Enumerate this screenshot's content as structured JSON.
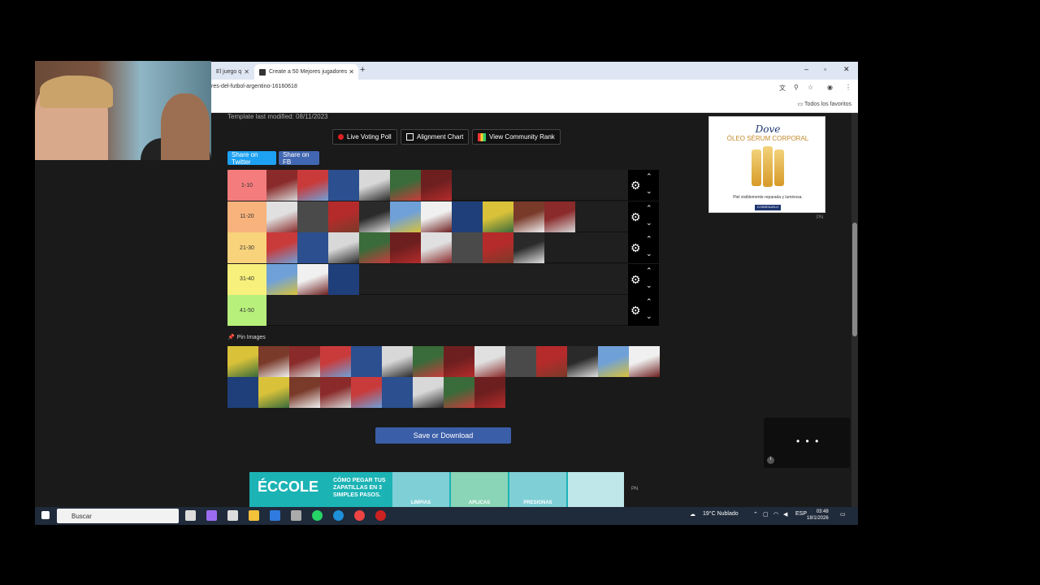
{
  "browser": {
    "tabs": [
      {
        "label": "El juego q"
      },
      {
        "label": "Create a 50 Mejores jugadores"
      }
    ],
    "new_tab": "+",
    "window_controls": {
      "minimize": "–",
      "maximize": "▫",
      "close": "✕"
    },
    "url": "res-del-futbol-argentino-16160618",
    "bookmarks_label": "Todos los favoritos"
  },
  "page": {
    "template_modified": "Template last modified: 08/11/2023",
    "buttons": {
      "live_voting": "Live Voting Poll",
      "alignment": "Alignment Chart",
      "community": "View Community Rank"
    },
    "share": {
      "twitter": "Share on Twitter",
      "facebook": "Share on FB"
    },
    "tiers": [
      {
        "label": "1-10",
        "color": "#f47c7c",
        "count": 6
      },
      {
        "label": "11-20",
        "color": "#f8b37c",
        "count": 10
      },
      {
        "label": "21-30",
        "color": "#f9d27c",
        "count": 9
      },
      {
        "label": "31-40",
        "color": "#f8f07c",
        "count": 3
      },
      {
        "label": "41-50",
        "color": "#b8f07c",
        "count": 0
      }
    ],
    "pin_images": "Pin Images",
    "pool_count": 23,
    "save_button": "Save or Download"
  },
  "ads": {
    "right": {
      "brand": "Dove",
      "product": "ÓLEO SÉRUM CORPORAL",
      "tagline": "Piel visiblemente reparada y luminosa.",
      "cta": "CONSÍGUELO",
      "label": "PN"
    },
    "bottom": {
      "logo": "ÉCCOLE",
      "headline": "CÓMO PEGAR TUS ZAPATILLAS EN 3 SIMPLES PASOS.",
      "steps": [
        "LIMPIAS",
        "APLICAS",
        "PRESIONAS"
      ],
      "label": "PN"
    },
    "video_dots": "• • •"
  },
  "taskbar": {
    "search_placeholder": "Buscar",
    "weather": "19°C  Nublado",
    "lang": "ESP",
    "time": "03:48",
    "date": "18/1/2026"
  },
  "colors": {
    "accent": "#3b5ea8",
    "twitter": "#1da1f2",
    "facebook": "#4267b2"
  }
}
